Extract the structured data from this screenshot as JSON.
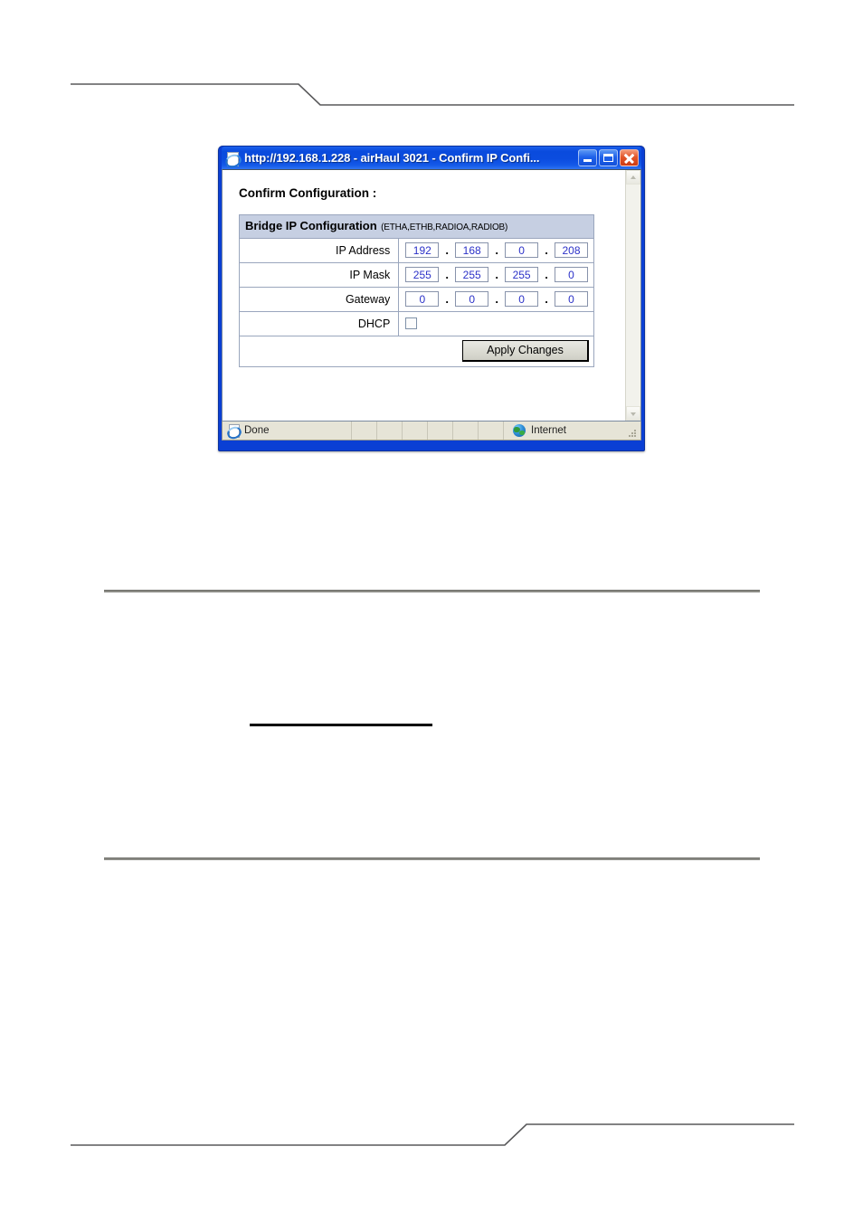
{
  "page": {
    "background": "#ffffff",
    "header_rule": "decorative-stepped-rule",
    "footer_rule": "decorative-stepped-rule"
  },
  "browser_window": {
    "title": "http://192.168.1.228 - airHaul 3021 - Confirm IP Confi...",
    "title_bar_color": "#0a4bdd",
    "document_icon": "ie-page-icon",
    "buttons": {
      "minimize": "minimize-button",
      "maximize": "maximize-button",
      "close": "close-button"
    },
    "scrollbar": {
      "up_arrow": "scroll-up-arrow",
      "down_arrow": "scroll-down-arrow"
    },
    "status_bar": {
      "status_text": "Done",
      "status_icon": "ie-page-icon",
      "zone_text": "Internet",
      "zone_icon": "globe-icon",
      "empty_panes": 6
    }
  },
  "content": {
    "heading": "Confirm Configuration :",
    "table": {
      "header_title": "Bridge IP Configuration",
      "header_subtitle": "(ETHA,ETHB,RADIOA,RADIOB)",
      "header_bg": "#c6cfe2",
      "border_color": "#9aa6bd",
      "field_text_color": "#2b31c8",
      "rows": [
        {
          "label": "IP Address",
          "type": "ip",
          "octets": [
            "192",
            "168",
            "0",
            "208"
          ]
        },
        {
          "label": "IP Mask",
          "type": "ip",
          "octets": [
            "255",
            "255",
            "255",
            "0"
          ]
        },
        {
          "label": "Gateway",
          "type": "ip",
          "octets": [
            "0",
            "0",
            "0",
            "0"
          ]
        },
        {
          "label": "DHCP",
          "type": "checkbox",
          "checked": false
        }
      ],
      "separator": ".",
      "apply_button": "Apply Changes"
    }
  }
}
